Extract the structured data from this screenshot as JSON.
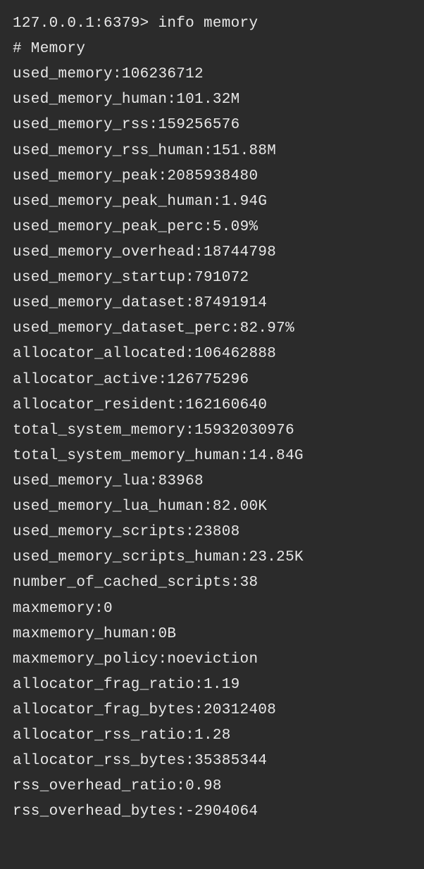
{
  "prompt": "127.0.0.1:6379> ",
  "command": "info memory",
  "section_header": "# Memory",
  "entries": [
    {
      "key": "used_memory",
      "value": "106236712"
    },
    {
      "key": "used_memory_human",
      "value": "101.32M"
    },
    {
      "key": "used_memory_rss",
      "value": "159256576"
    },
    {
      "key": "used_memory_rss_human",
      "value": "151.88M"
    },
    {
      "key": "used_memory_peak",
      "value": "2085938480"
    },
    {
      "key": "used_memory_peak_human",
      "value": "1.94G"
    },
    {
      "key": "used_memory_peak_perc",
      "value": "5.09%"
    },
    {
      "key": "used_memory_overhead",
      "value": "18744798"
    },
    {
      "key": "used_memory_startup",
      "value": "791072"
    },
    {
      "key": "used_memory_dataset",
      "value": "87491914"
    },
    {
      "key": "used_memory_dataset_perc",
      "value": "82.97%"
    },
    {
      "key": "allocator_allocated",
      "value": "106462888"
    },
    {
      "key": "allocator_active",
      "value": "126775296"
    },
    {
      "key": "allocator_resident",
      "value": "162160640"
    },
    {
      "key": "total_system_memory",
      "value": "15932030976"
    },
    {
      "key": "total_system_memory_human",
      "value": "14.84G"
    },
    {
      "key": "used_memory_lua",
      "value": "83968"
    },
    {
      "key": "used_memory_lua_human",
      "value": "82.00K"
    },
    {
      "key": "used_memory_scripts",
      "value": "23808"
    },
    {
      "key": "used_memory_scripts_human",
      "value": "23.25K"
    },
    {
      "key": "number_of_cached_scripts",
      "value": "38"
    },
    {
      "key": "maxmemory",
      "value": "0"
    },
    {
      "key": "maxmemory_human",
      "value": "0B"
    },
    {
      "key": "maxmemory_policy",
      "value": "noeviction"
    },
    {
      "key": "allocator_frag_ratio",
      "value": "1.19"
    },
    {
      "key": "allocator_frag_bytes",
      "value": "20312408"
    },
    {
      "key": "allocator_rss_ratio",
      "value": "1.28"
    },
    {
      "key": "allocator_rss_bytes",
      "value": "35385344"
    },
    {
      "key": "rss_overhead_ratio",
      "value": "0.98"
    },
    {
      "key": "rss_overhead_bytes",
      "value": "-2904064"
    }
  ]
}
